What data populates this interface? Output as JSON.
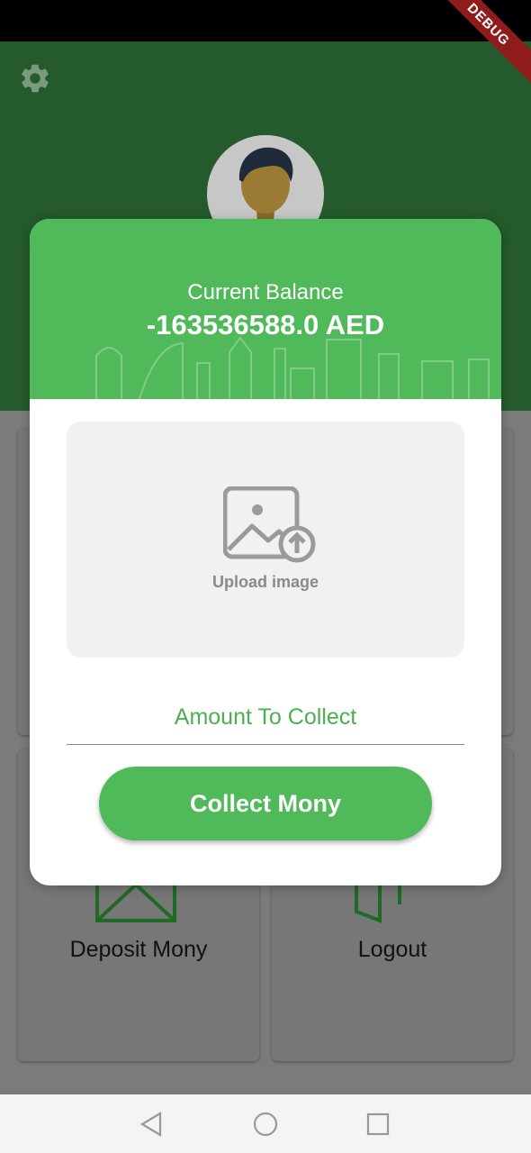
{
  "debug_banner": "DEBUG",
  "header": {
    "settings_icon": "gear-icon",
    "avatar_icon": "user-avatar"
  },
  "menu": {
    "deposit_label": "Deposit Mony",
    "logout_label": "Logout"
  },
  "dialog": {
    "balance_label": "Current Balance",
    "balance_value": "-163536588.0 AED",
    "upload_label": "Upload image",
    "amount_placeholder": "Amount To Collect",
    "amount_value": "",
    "collect_button": "Collect Mony"
  },
  "colors": {
    "header_green": "#255a2c",
    "accent_green": "#50b95a",
    "overlay_gray": "#7a7a7a"
  },
  "nav": {
    "back_icon": "triangle-back-icon",
    "home_icon": "circle-home-icon",
    "recents_icon": "square-recents-icon"
  }
}
